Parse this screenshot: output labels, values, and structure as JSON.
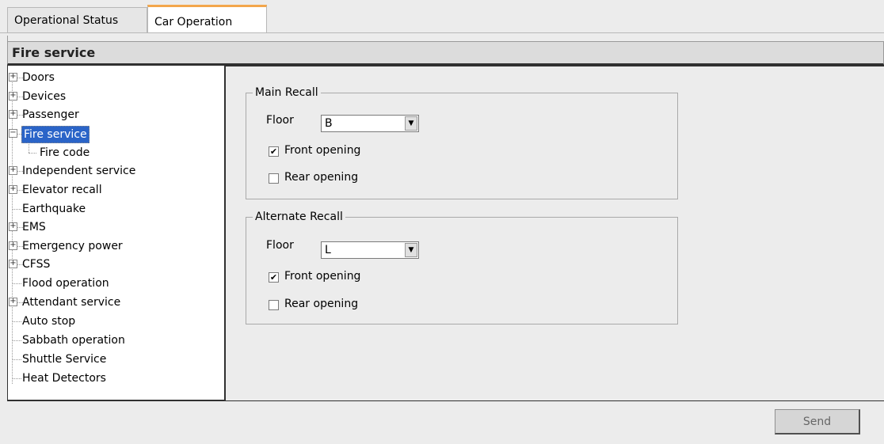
{
  "tabs": [
    {
      "label": "Operational Status"
    },
    {
      "label": "Car Operation"
    }
  ],
  "accent_color": "#f3a64b",
  "selection_color": "#2a64c8",
  "title": "Fire service",
  "tree": [
    {
      "label": "Doors",
      "expandable": true
    },
    {
      "label": "Devices",
      "expandable": true
    },
    {
      "label": "Passenger",
      "expandable": true
    },
    {
      "label": "Fire service",
      "expandable": true,
      "expanded": true,
      "selected": true
    },
    {
      "label": "Fire code",
      "child": true
    },
    {
      "label": "Independent service",
      "expandable": true
    },
    {
      "label": "Elevator recall",
      "expandable": true
    },
    {
      "label": "Earthquake"
    },
    {
      "label": "EMS",
      "expandable": true
    },
    {
      "label": "Emergency power",
      "expandable": true
    },
    {
      "label": "CFSS",
      "expandable": true
    },
    {
      "label": "Flood operation"
    },
    {
      "label": "Attendant service",
      "expandable": true
    },
    {
      "label": "Auto stop"
    },
    {
      "label": "Sabbath operation"
    },
    {
      "label": "Shuttle Service"
    },
    {
      "label": "Heat Detectors"
    }
  ],
  "main_recall": {
    "legend": "Main Recall",
    "floor_label": "Floor",
    "floor_value": "B",
    "front_label": "Front opening",
    "front_checked": true,
    "rear_label": "Rear opening",
    "rear_checked": false
  },
  "alternate_recall": {
    "legend": "Alternate Recall",
    "floor_label": "Floor",
    "floor_value": "L",
    "front_label": "Front opening",
    "front_checked": true,
    "rear_label": "Rear opening",
    "rear_checked": false
  },
  "send_label": "Send"
}
